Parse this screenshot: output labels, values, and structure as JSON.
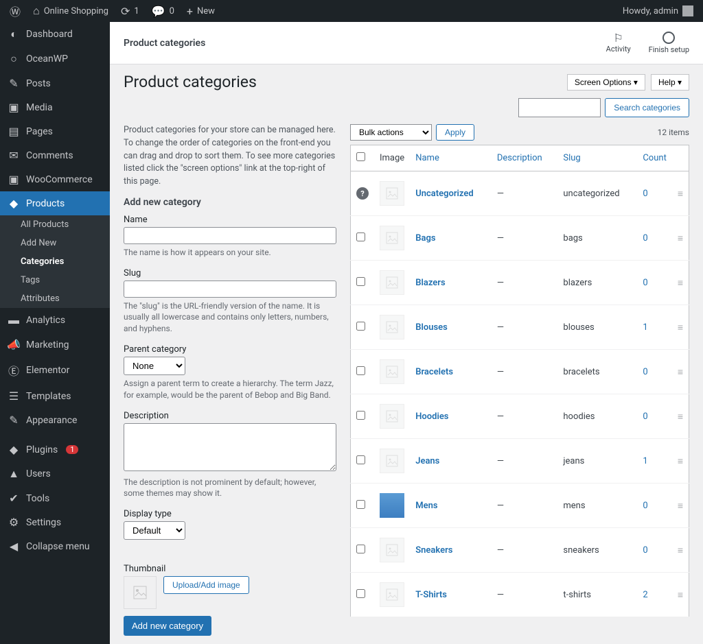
{
  "adminbar": {
    "site_name": "Online Shopping",
    "updates": "1",
    "comments": "0",
    "new": "New",
    "howdy": "Howdy, admin"
  },
  "sidebar": {
    "items": [
      {
        "icon": "◐",
        "label": "Dashboard"
      },
      {
        "icon": "○",
        "label": "OceanWP"
      },
      {
        "icon": "✎",
        "label": "Posts"
      },
      {
        "icon": "▣",
        "label": "Media"
      },
      {
        "icon": "▤",
        "label": "Pages"
      },
      {
        "icon": "✉",
        "label": "Comments"
      },
      {
        "icon": "▣",
        "label": "WooCommerce"
      },
      {
        "icon": "◆",
        "label": "Products",
        "current": true
      },
      {
        "icon": "▬",
        "label": "Analytics"
      },
      {
        "icon": "📣",
        "label": "Marketing"
      },
      {
        "icon": "Ⓔ",
        "label": "Elementor"
      },
      {
        "icon": "☰",
        "label": "Templates"
      },
      {
        "icon": "✎",
        "label": "Appearance"
      },
      {
        "icon": "◆",
        "label": "Plugins",
        "badge": "1"
      },
      {
        "icon": "▲",
        "label": "Users"
      },
      {
        "icon": "✔",
        "label": "Tools"
      },
      {
        "icon": "⚙",
        "label": "Settings"
      },
      {
        "icon": "◀",
        "label": "Collapse menu"
      }
    ],
    "submenu": [
      "All Products",
      "Add New",
      "Categories",
      "Tags",
      "Attributes"
    ],
    "submenu_active": "Categories"
  },
  "header": {
    "breadcrumb": "Product categories",
    "activity": "Activity",
    "finish": "Finish setup"
  },
  "page": {
    "title": "Product categories",
    "screen_options": "Screen Options ▾",
    "help": "Help ▾",
    "search_btn": "Search categories",
    "intro": "Product categories for your store can be managed here. To change the order of categories on the front-end you can drag and drop to sort them. To see more categories listed click the \"screen options\" link at the top-right of this page.",
    "form_heading": "Add new category",
    "name_label": "Name",
    "name_help": "The name is how it appears on your site.",
    "slug_label": "Slug",
    "slug_help": "The \"slug\" is the URL-friendly version of the name. It is usually all lowercase and contains only letters, numbers, and hyphens.",
    "parent_label": "Parent category",
    "parent_value": "None",
    "parent_help": "Assign a parent term to create a hierarchy. The term Jazz, for example, would be the parent of Bebop and Big Band.",
    "desc_label": "Description",
    "desc_help": "The description is not prominent by default; however, some themes may show it.",
    "display_label": "Display type",
    "display_value": "Default",
    "thumb_label": "Thumbnail",
    "upload_btn": "Upload/Add image",
    "submit_btn": "Add new category",
    "bulk_value": "Bulk actions",
    "apply": "Apply",
    "items_count": "12 items",
    "th": {
      "image": "Image",
      "name": "Name",
      "desc": "Description",
      "slug": "Slug",
      "count": "Count"
    },
    "rows": [
      {
        "name": "Uncategorized",
        "desc": "—",
        "slug": "uncategorized",
        "count": "0",
        "q": true
      },
      {
        "name": "Bags",
        "desc": "—",
        "slug": "bags",
        "count": "0"
      },
      {
        "name": "Blazers",
        "desc": "—",
        "slug": "blazers",
        "count": "0"
      },
      {
        "name": "Blouses",
        "desc": "—",
        "slug": "blouses",
        "count": "1"
      },
      {
        "name": "Bracelets",
        "desc": "—",
        "slug": "bracelets",
        "count": "0"
      },
      {
        "name": "Hoodies",
        "desc": "—",
        "slug": "hoodies",
        "count": "0"
      },
      {
        "name": "Jeans",
        "desc": "—",
        "slug": "jeans",
        "count": "1"
      },
      {
        "name": "Mens",
        "desc": "—",
        "slug": "mens",
        "count": "0",
        "avatar": true
      },
      {
        "name": "Sneakers",
        "desc": "—",
        "slug": "sneakers",
        "count": "0"
      },
      {
        "name": "T-Shirts",
        "desc": "—",
        "slug": "t-shirts",
        "count": "2"
      }
    ]
  }
}
